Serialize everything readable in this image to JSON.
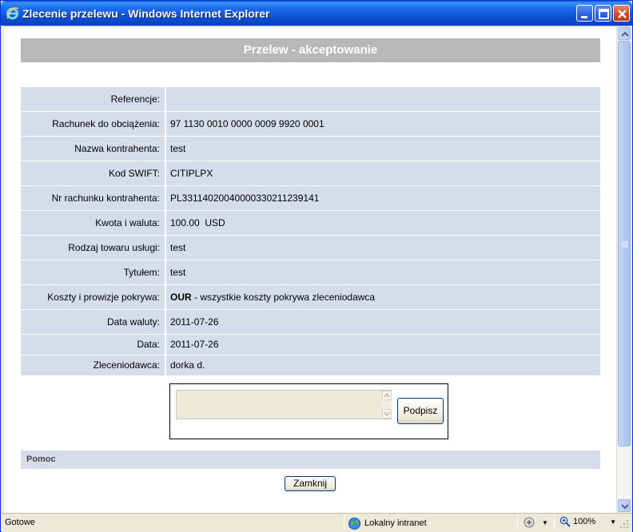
{
  "window": {
    "title": "Zlecenie przelewu - Windows Internet Explorer",
    "icon": "ie-icon"
  },
  "page": {
    "header": "Przelew - akceptowanie",
    "rows": [
      {
        "label": "Referencje:",
        "value": ""
      },
      {
        "label": "Rachunek do obciążenia:",
        "value": "97 1130 0010 0000 0009 9920 0001"
      },
      {
        "label": "Nazwa kontrahenta:",
        "value": "test"
      },
      {
        "label": "Kod SWIFT:",
        "value": "CITIPLPX"
      },
      {
        "label": "Nr rachunku kontrahenta:",
        "value": "PL33114020040000330211239141"
      },
      {
        "label": "Kwota i waluta:",
        "value": "100.00  USD"
      },
      {
        "label": "Rodzaj towaru usługi:",
        "value": "test"
      },
      {
        "label": "Tytułem:",
        "value": "test"
      },
      {
        "label": "Koszty i prowizje pokrywa:",
        "value_bold": "OUR",
        "value": " - wszystkie koszty pokrywa zleceniodawca"
      },
      {
        "label": "Data waluty:",
        "value": "2011-07-26"
      },
      {
        "label": "Data:",
        "value": "2011-07-26"
      },
      {
        "label": "Zleceniodawca:",
        "value": "dorka d."
      }
    ],
    "sign_button": "Podpisz",
    "help_label": "Pomoc",
    "close_button": "Zamknij"
  },
  "statusbar": {
    "status": "Gotowe",
    "zone": "Lokalny intranet",
    "zoom": "100%"
  },
  "colors": {
    "row_bg": "#d5dcea",
    "header_bg": "#b8b8b8",
    "titlebar": "#0b4fd0"
  }
}
